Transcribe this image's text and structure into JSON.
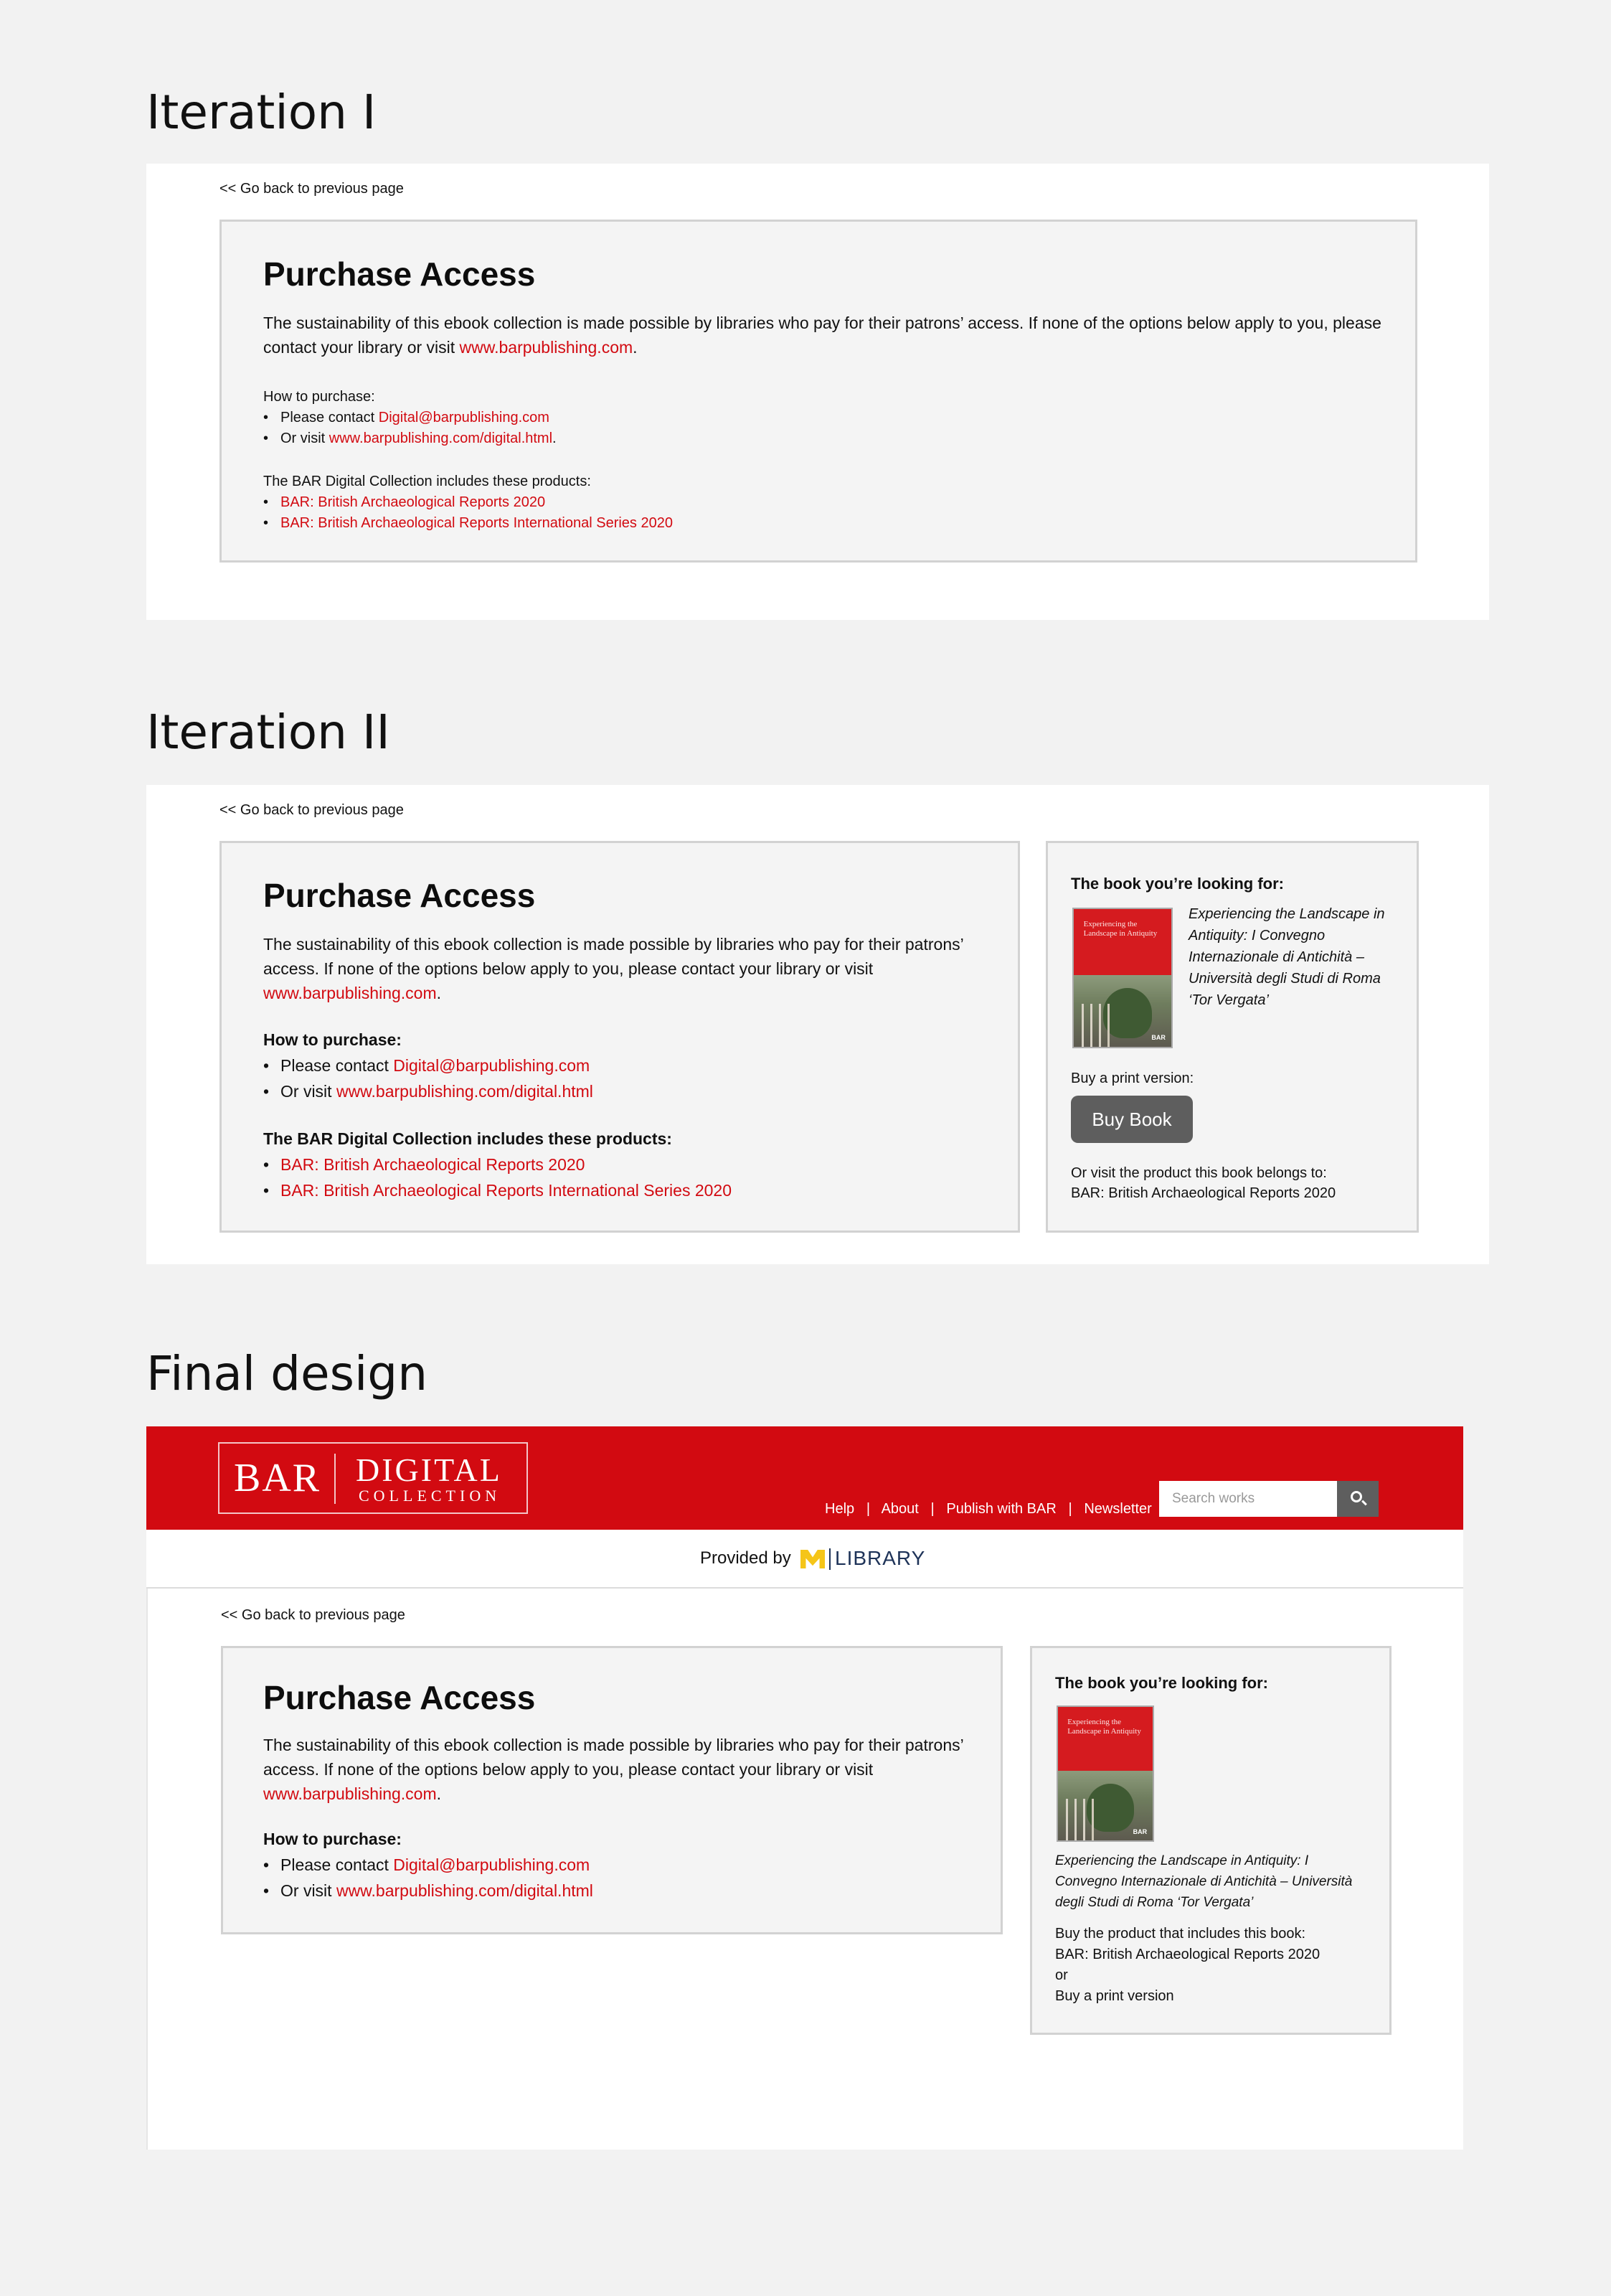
{
  "sections": {
    "iter1_title": "Iteration I",
    "iter2_title": "Iteration II",
    "final_title": "Final design"
  },
  "common": {
    "back_link": "<< Go back to previous page",
    "purchase_title": "Purchase Access",
    "sustain_text": "The sustainability of this ebook collection is made possible by libraries who pay for their patrons’ access. If none of the options below apply to you, please contact your library or visit ",
    "site_link": "www.barpublishing.com",
    "period": ".",
    "how_to_purchase": "How to purchase:",
    "please_contact": "Please contact ",
    "email_link": "Digital@barpublishing.com",
    "or_visit": "Or visit ",
    "digital_link": "www.barpublishing.com/digital.html",
    "collection_includes": "The BAR Digital Collection includes these products:",
    "product1": "BAR: British Archaeological Reports 2020",
    "product2": "BAR: British Archaeological Reports International Series 2020"
  },
  "book": {
    "looking_for": "The book you’re looking for:",
    "title": "Experiencing the Landscape in Antiquity: I Convegno Internazionale di Antichità – Università degli Studi di Roma ‘Tor Vergata’",
    "cover_title": "Experiencing the Landscape in Antiquity",
    "cover_brand": "BAR",
    "buy_print_label": "Buy a print version:",
    "buy_button": "Buy Book",
    "or_visit_product": "Or visit the product this book belongs to:",
    "product_link": "BAR: British Archaeological Reports 2020",
    "buy_product_label": "Buy the product that includes this book:",
    "or": "or",
    "buy_print_link": "Buy a print version"
  },
  "header": {
    "logo_bar": "BAR",
    "logo_digital": "DIGITAL",
    "logo_collection": "COLLECTION",
    "nav": [
      "Help",
      "About",
      "Publish with BAR",
      "Newsletter"
    ],
    "nav_sep": "|",
    "search_placeholder": "Search works",
    "provided_by": "Provided by",
    "library": "LIBRARY"
  },
  "colors": {
    "brand_red": "#d20a11",
    "button_gray": "#5e5e5e",
    "michigan_maize": "#f5c518",
    "michigan_blue": "#1e3358"
  },
  "icons": [
    "search-icon",
    "michigan-m-icon"
  ]
}
